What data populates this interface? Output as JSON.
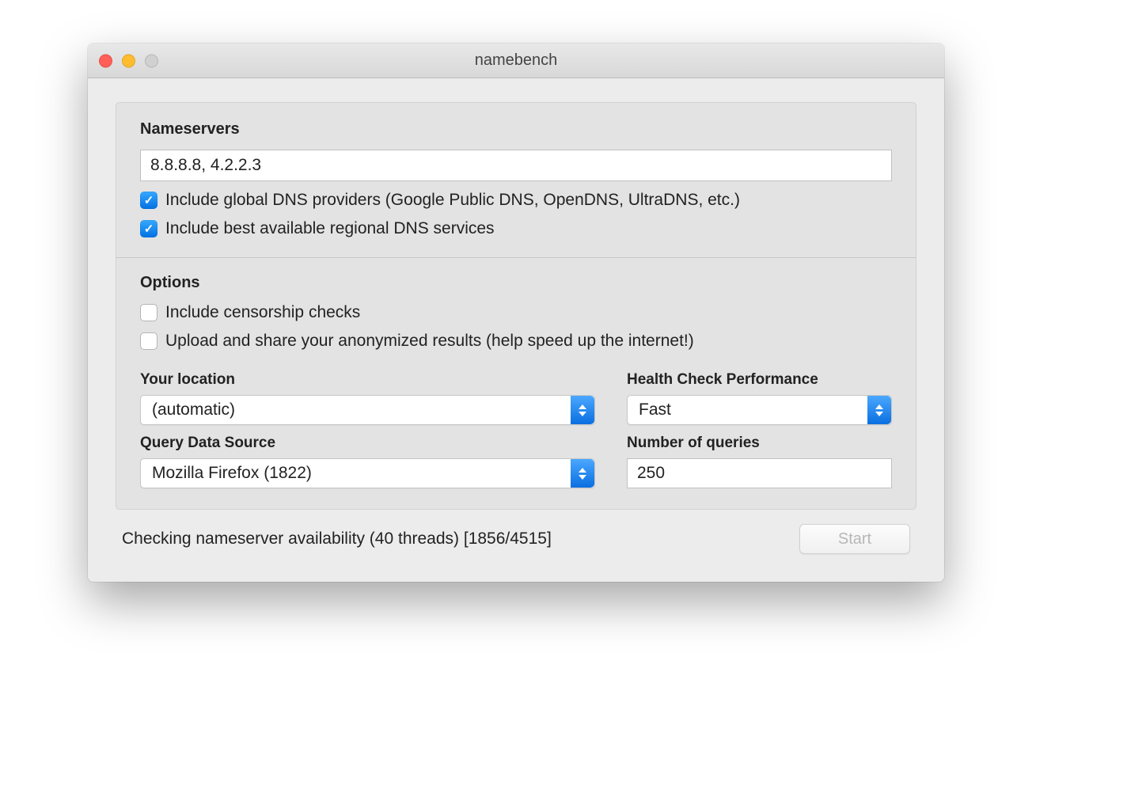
{
  "window": {
    "title": "namebench"
  },
  "nameservers": {
    "heading": "Nameservers",
    "value": "8.8.8.8, 4.2.2.3",
    "include_global_label": "Include global DNS providers (Google Public DNS, OpenDNS, UltraDNS, etc.)",
    "include_global_checked": true,
    "include_regional_label": "Include best available regional DNS services",
    "include_regional_checked": true
  },
  "options": {
    "heading": "Options",
    "censorship_label": "Include censorship checks",
    "censorship_checked": false,
    "upload_label": "Upload and share your anonymized results (help speed up the internet!)",
    "upload_checked": false
  },
  "location": {
    "label": "Your location",
    "value": "(automatic)"
  },
  "health": {
    "label": "Health Check Performance",
    "value": "Fast"
  },
  "source": {
    "label": "Query Data Source",
    "value": "Mozilla Firefox (1822)"
  },
  "queries": {
    "label": "Number of queries",
    "value": "250"
  },
  "footer": {
    "status": "Checking nameserver availability (40 threads) [1856/4515]",
    "start_label": "Start"
  }
}
